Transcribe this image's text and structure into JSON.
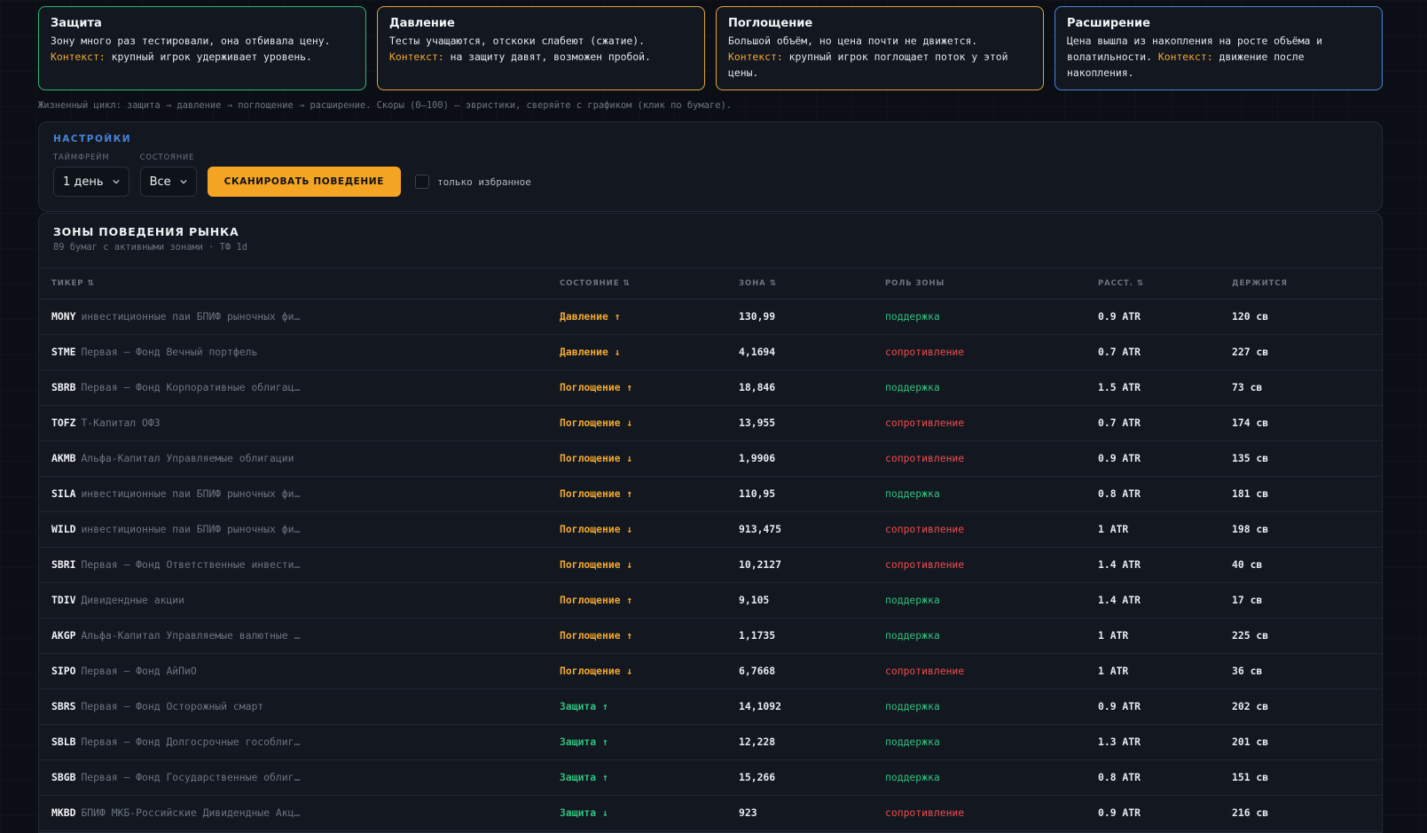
{
  "cards": [
    {
      "title": "Защита",
      "text": "Зону много раз тестировали, она отбивала цену.",
      "ctx_label": "Контекст:",
      "ctx": "крупный игрок удерживает уровень."
    },
    {
      "title": "Давление",
      "text": "Тесты учащаются, отскоки слабеют (сжатие).",
      "ctx_label": "Контекст:",
      "ctx": "на защиту давят, возможен пробой."
    },
    {
      "title": "Поглощение",
      "text": "Большой объём, но цена почти не движется.",
      "ctx_label": "Контекст:",
      "ctx": "крупный игрок поглощает поток у этой цены."
    },
    {
      "title": "Расширение",
      "text": "Цена вышла из накопления на росте объёма и волатильности.",
      "ctx_label": "Контекст:",
      "ctx": "движение после накопления."
    }
  ],
  "lifecycle": "Жизненный цикл: защита → давление → поглощение → расширение. Скоры (0–100) — эвристики, сверяйте с графиком (клик по бумаге).",
  "settings": {
    "title": "НАСТРОЙКИ",
    "timeframe_label": "ТАЙМФРЕЙМ",
    "timeframe_value": "1 день",
    "state_label": "СОСТОЯНИЕ",
    "state_value": "Все",
    "scan_button": "СКАНИРОВАТЬ ПОВЕДЕНИЕ",
    "favorites_label": "только избранное"
  },
  "table": {
    "title": "ЗОНЫ ПОВЕДЕНИЯ РЫНКА",
    "subtitle": "89 бумаг с активными зонами · ТФ 1d",
    "headers": {
      "ticker": "ТИКЕР",
      "state": "СОСТОЯНИЕ",
      "zone": "ЗОНА",
      "role": "РОЛЬ ЗОНЫ",
      "dist": "РАССТ.",
      "holds": "ДЕРЖИТСЯ"
    },
    "sort_icon": "⇅",
    "rows": [
      {
        "ticker": "MONY",
        "name": "инвестиционные паи БПИФ рыночных фи…",
        "state": "Давление ↑",
        "state_color": "#f0a830",
        "zone": "130,99",
        "role": "поддержка",
        "role_color": "#2fc07e",
        "dist": "0.9 ATR",
        "holds": "120 св"
      },
      {
        "ticker": "STME",
        "name": "Первая – Фонд Вечный портфель",
        "state": "Давление ↓",
        "state_color": "#f0a830",
        "zone": "4,1694",
        "role": "сопротивление",
        "role_color": "#ef4d4d",
        "dist": "0.7 ATR",
        "holds": "227 св"
      },
      {
        "ticker": "SBRB",
        "name": "Первая – Фонд Корпоративные облигац…",
        "state": "Поглощение ↑",
        "state_color": "#f0a830",
        "zone": "18,846",
        "role": "поддержка",
        "role_color": "#2fc07e",
        "dist": "1.5 ATR",
        "holds": "73 св"
      },
      {
        "ticker": "TOFZ",
        "name": "Т-Капитал ОФЗ",
        "state": "Поглощение ↓",
        "state_color": "#f0a830",
        "zone": "13,955",
        "role": "сопротивление",
        "role_color": "#ef4d4d",
        "dist": "0.7 ATR",
        "holds": "174 св"
      },
      {
        "ticker": "AKMB",
        "name": "Альфа-Капитал Управляемые облигации",
        "state": "Поглощение ↓",
        "state_color": "#f0a830",
        "zone": "1,9906",
        "role": "сопротивление",
        "role_color": "#ef4d4d",
        "dist": "0.9 ATR",
        "holds": "135 св"
      },
      {
        "ticker": "SILA",
        "name": "инвестиционные паи БПИФ рыночных фи…",
        "state": "Поглощение ↑",
        "state_color": "#f0a830",
        "zone": "110,95",
        "role": "поддержка",
        "role_color": "#2fc07e",
        "dist": "0.8 ATR",
        "holds": "181 св"
      },
      {
        "ticker": "WILD",
        "name": "инвестиционные паи БПИФ рыночных фи…",
        "state": "Поглощение ↓",
        "state_color": "#f0a830",
        "zone": "913,475",
        "role": "сопротивление",
        "role_color": "#ef4d4d",
        "dist": "1 ATR",
        "holds": "198 св"
      },
      {
        "ticker": "SBRI",
        "name": "Первая – Фонд Ответственные инвести…",
        "state": "Поглощение ↓",
        "state_color": "#f0a830",
        "zone": "10,2127",
        "role": "сопротивление",
        "role_color": "#ef4d4d",
        "dist": "1.4 ATR",
        "holds": "40 св"
      },
      {
        "ticker": "TDIV",
        "name": "Дивидендные акции",
        "state": "Поглощение ↑",
        "state_color": "#f0a830",
        "zone": "9,105",
        "role": "поддержка",
        "role_color": "#2fc07e",
        "dist": "1.4 ATR",
        "holds": "17 св"
      },
      {
        "ticker": "AKGP",
        "name": "Альфа-Капитал Управляемые валютные …",
        "state": "Поглощение ↑",
        "state_color": "#f0a830",
        "zone": "1,1735",
        "role": "поддержка",
        "role_color": "#2fc07e",
        "dist": "1 ATR",
        "holds": "225 св"
      },
      {
        "ticker": "SIPO",
        "name": "Первая – Фонд АйПиО",
        "state": "Поглощение ↓",
        "state_color": "#f0a830",
        "zone": "6,7668",
        "role": "сопротивление",
        "role_color": "#ef4d4d",
        "dist": "1 ATR",
        "holds": "36 св"
      },
      {
        "ticker": "SBRS",
        "name": "Первая – Фонд Осторожный смарт",
        "state": "Защита ↑",
        "state_color": "#2fc07e",
        "zone": "14,1092",
        "role": "поддержка",
        "role_color": "#2fc07e",
        "dist": "0.9 ATR",
        "holds": "202 св"
      },
      {
        "ticker": "SBLB",
        "name": "Первая – Фонд Долгосрочные гособлиг…",
        "state": "Защита ↑",
        "state_color": "#2fc07e",
        "zone": "12,228",
        "role": "поддержка",
        "role_color": "#2fc07e",
        "dist": "1.3 ATR",
        "holds": "201 св"
      },
      {
        "ticker": "SBGB",
        "name": "Первая – Фонд Государственные облиг…",
        "state": "Защита ↑",
        "state_color": "#2fc07e",
        "zone": "15,266",
        "role": "поддержка",
        "role_color": "#2fc07e",
        "dist": "0.8 ATR",
        "holds": "151 св"
      },
      {
        "ticker": "MKBD",
        "name": "БПИФ МКБ-Российские Дивидендные Акц…",
        "state": "Защита ↓",
        "state_color": "#2fc07e",
        "zone": "923",
        "role": "сопротивление",
        "role_color": "#ef4d4d",
        "dist": "0.9 ATR",
        "holds": "216 св"
      }
    ]
  }
}
